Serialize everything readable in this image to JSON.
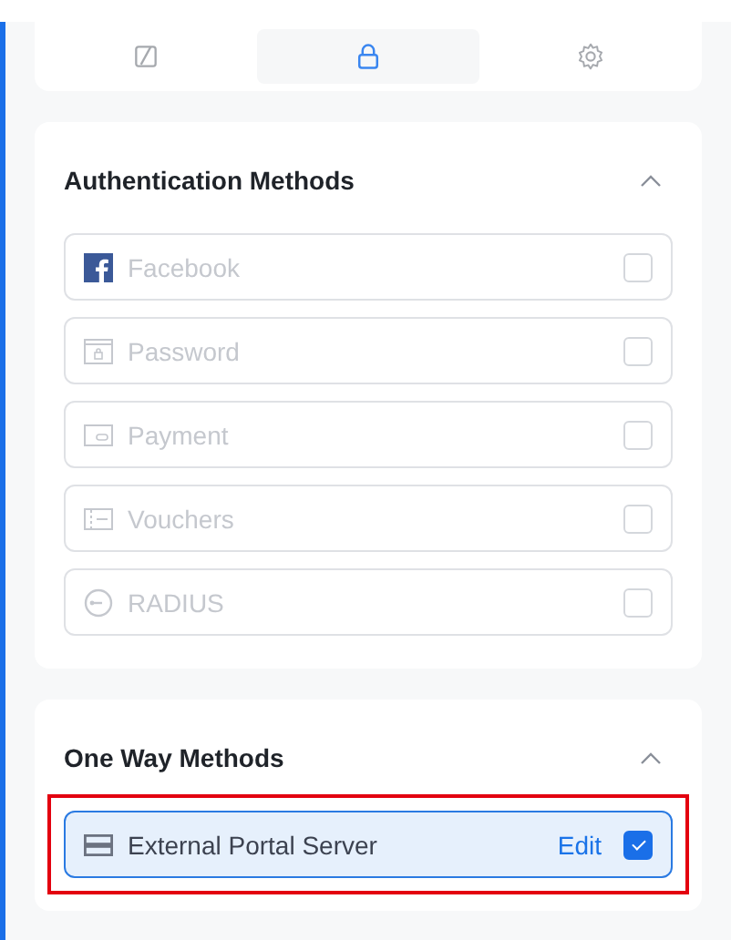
{
  "tabs": [
    {
      "selected": false
    },
    {
      "selected": true
    },
    {
      "selected": false
    }
  ],
  "sections": [
    {
      "title": "Authentication Methods",
      "expanded": true,
      "items": [
        {
          "label": "Facebook",
          "disabled": true,
          "selected": false,
          "checked": false,
          "highlighted": false
        },
        {
          "label": "Password",
          "disabled": true,
          "selected": false,
          "checked": false,
          "highlighted": false
        },
        {
          "label": "Payment",
          "disabled": true,
          "selected": false,
          "checked": false,
          "highlighted": false
        },
        {
          "label": "Vouchers",
          "disabled": true,
          "selected": false,
          "checked": false,
          "highlighted": false
        },
        {
          "label": "RADIUS",
          "disabled": true,
          "selected": false,
          "checked": false,
          "highlighted": false
        }
      ]
    },
    {
      "title": "One Way Methods",
      "expanded": true,
      "items": [
        {
          "label": "External Portal Server",
          "action": "Edit",
          "disabled": false,
          "selected": true,
          "checked": true,
          "highlighted": true
        }
      ]
    }
  ]
}
